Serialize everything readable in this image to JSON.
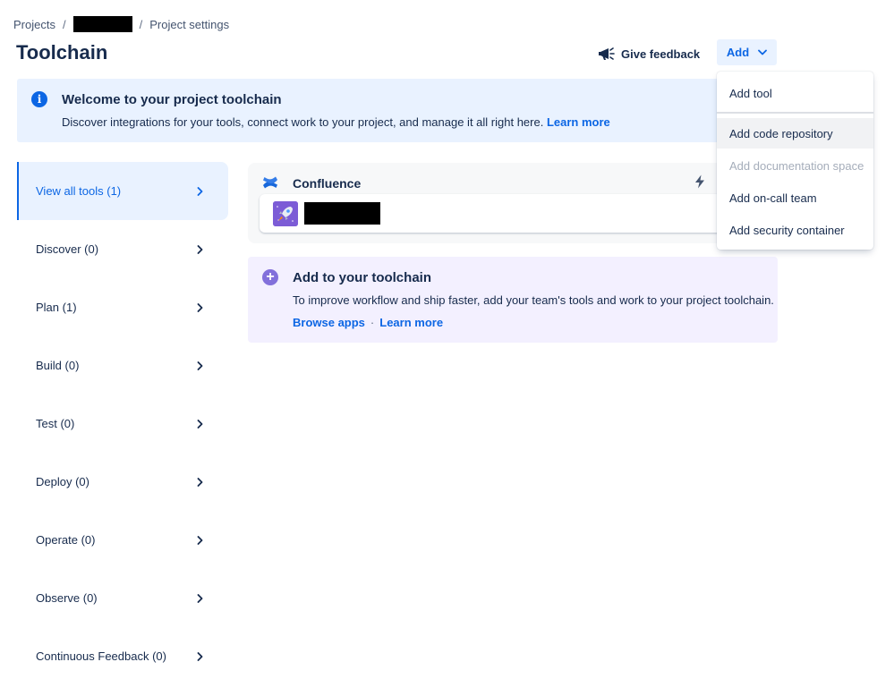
{
  "breadcrumb": {
    "projects": "Projects",
    "sep1": "/",
    "sep2": "/",
    "settings": "Project settings"
  },
  "page": {
    "title": "Toolchain"
  },
  "header": {
    "feedback_label": "Give feedback",
    "add_label": "Add"
  },
  "banner": {
    "title": "Welcome to your project toolchain",
    "description": "Discover integrations for your tools, connect work to your project, and manage it all right here.",
    "link": "Learn more"
  },
  "sidebar": {
    "items": [
      {
        "label": "View all tools (1)"
      },
      {
        "label": "Discover (0)"
      },
      {
        "label": "Plan (1)"
      },
      {
        "label": "Build (0)"
      },
      {
        "label": "Test (0)"
      },
      {
        "label": "Deploy (0)"
      },
      {
        "label": "Operate (0)"
      },
      {
        "label": "Observe (0)"
      },
      {
        "label": "Continuous Feedback (0)"
      }
    ]
  },
  "tool_card": {
    "name": "Confluence"
  },
  "add_card": {
    "title": "Add to your toolchain",
    "description": "To improve workflow and ship faster, add your team's tools and work to your project toolchain.",
    "browse_link": "Browse apps",
    "separator": "·",
    "learn_link": "Learn more"
  },
  "dropdown": {
    "items": [
      {
        "label": "Add tool"
      },
      {
        "label": "Add code repository"
      },
      {
        "label": "Add documentation space"
      },
      {
        "label": "Add on-call team"
      },
      {
        "label": "Add security container"
      }
    ]
  },
  "colors": {
    "accent": "#0c66e4",
    "banner_bg": "#e9f2ff",
    "add_card_bg": "#f3f0ff",
    "plus_icon": "#8270db",
    "text": "#172b4d"
  },
  "icons": {
    "feedback": "megaphone-icon",
    "add_chevron": "chevron-down-icon",
    "banner": "info-icon",
    "sidebar": "chevron-right-icon",
    "tool_logo": "confluence-logo-icon",
    "automation": "lightning-bolt-icon",
    "add_card": "plus-circle-icon"
  }
}
